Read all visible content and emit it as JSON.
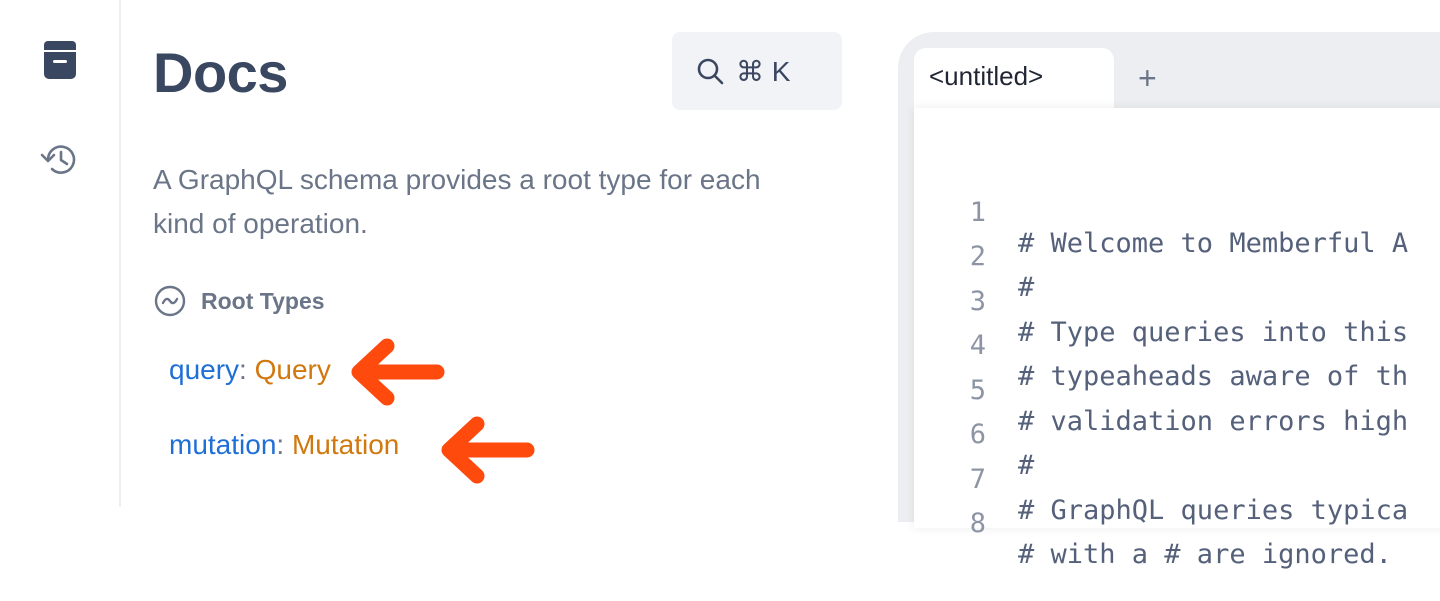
{
  "sidebar": {
    "items": [
      {
        "icon": "book-icon",
        "name": "docs"
      },
      {
        "icon": "history-icon",
        "name": "history"
      }
    ]
  },
  "docs": {
    "title": "Docs",
    "search_shortcut": "⌘ K",
    "description": "A GraphQL schema provides a root type for each kind of operation.",
    "root_types_label": "Root Types",
    "root_types": [
      {
        "name": "query",
        "type": "Query"
      },
      {
        "name": "mutation",
        "type": "Mutation"
      }
    ]
  },
  "editor": {
    "tab_label": "<untitled>",
    "add_tab_label": "+",
    "lines": [
      {
        "num": "1",
        "text": "# Welcome to Memberful A"
      },
      {
        "num": "2",
        "text": "#"
      },
      {
        "num": "3",
        "text": "# Type queries into this"
      },
      {
        "num": "4",
        "text": "# typeaheads aware of th"
      },
      {
        "num": "5",
        "text": "# validation errors high"
      },
      {
        "num": "6",
        "text": "#"
      },
      {
        "num": "7",
        "text": "# GraphQL queries typica"
      },
      {
        "num": "8",
        "text": "# with a # are ignored."
      }
    ]
  },
  "colors": {
    "title": "#3a4760",
    "field_name": "#1f6fd6",
    "field_type": "#d1780f",
    "annotation_arrow": "#ff4a0d"
  }
}
